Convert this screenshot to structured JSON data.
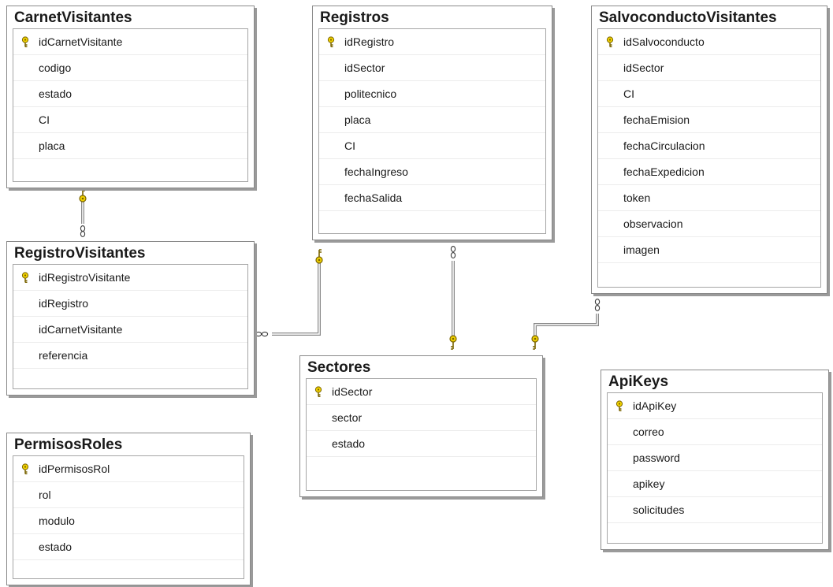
{
  "colors": {
    "key_fill": "#f1d200",
    "key_stroke": "#7a6400",
    "connector": "#8a8a8a",
    "table_border": "#8a8a8a"
  },
  "tables": {
    "carnet_visitantes": {
      "title": "CarnetVisitantes",
      "columns": [
        "idCarnetVisitante",
        "codigo",
        "estado",
        "CI",
        "placa"
      ]
    },
    "registros": {
      "title": "Registros",
      "columns": [
        "idRegistro",
        "idSector",
        "politecnico",
        "placa",
        "CI",
        "fechaIngreso",
        "fechaSalida"
      ]
    },
    "salvoconducto_visitantes": {
      "title": "SalvoconductoVisitantes",
      "columns": [
        "idSalvoconducto",
        "idSector",
        "CI",
        "fechaEmision",
        "fechaCirculacion",
        "fechaExpedicion",
        "token",
        "observacion",
        "imagen"
      ]
    },
    "registro_visitantes": {
      "title": "RegistroVisitantes",
      "columns": [
        "idRegistroVisitante",
        "idRegistro",
        "idCarnetVisitante",
        "referencia"
      ]
    },
    "sectores": {
      "title": "Sectores",
      "columns": [
        "idSector",
        "sector",
        "estado"
      ]
    },
    "permisos_roles": {
      "title": "PermisosRoles",
      "columns": [
        "idPermisosRol",
        "rol",
        "modulo",
        "estado"
      ]
    },
    "api_keys": {
      "title": "ApiKeys",
      "columns": [
        "idApiKey",
        "correo",
        "password",
        "apikey",
        "solicitudes"
      ]
    }
  }
}
